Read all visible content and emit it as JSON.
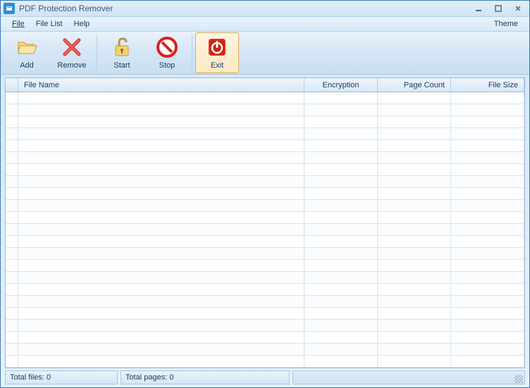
{
  "titlebar": {
    "title": "PDF Protection Remover"
  },
  "menu": {
    "file": "File",
    "filelist": "File List",
    "help": "Help",
    "theme": "Theme"
  },
  "toolbar": {
    "add": "Add",
    "remove": "Remove",
    "start": "Start",
    "stop": "Stop",
    "exit": "Exit"
  },
  "grid": {
    "headers": {
      "filename": "File Name",
      "encryption": "Encryption",
      "pagecount": "Page Count",
      "filesize": "File Size"
    },
    "rows": []
  },
  "status": {
    "totalFiles": "Total files: 0",
    "totalPages": "Total pages: 0"
  }
}
